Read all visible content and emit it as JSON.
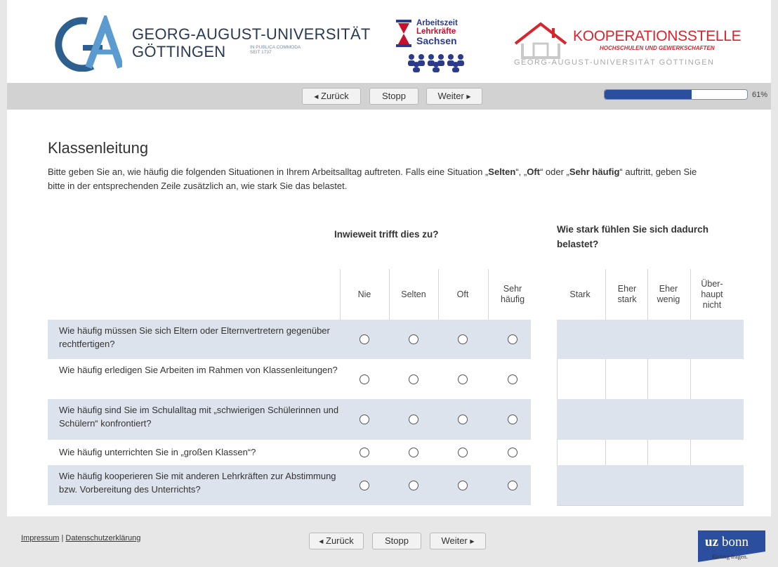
{
  "header": {
    "university": {
      "line1": "GEORG-AUGUST-UNIVERSITÄT",
      "line2": "GÖTTINGEN",
      "motto_line1": "IN PUBLICA COMMODA",
      "motto_line2": "SEIT 1737"
    },
    "alk": {
      "line1": "Arbeitszeit",
      "line2": "Lehrkräfte",
      "line3": "Sachsen"
    },
    "koop": {
      "title": "KOOPERATIONSSTELLE",
      "subtitle": "HOCHSCHULEN UND GEWERKSCHAFTEN",
      "university": "GEORG-AUGUST-UNIVERSITÄT GÖTTINGEN"
    }
  },
  "nav": {
    "back_label": "Zurück",
    "stop_label": "Stopp",
    "next_label": "Weiter",
    "progress_fraction": 0.61,
    "progress_text": "61%"
  },
  "content": {
    "title": "Klassenleitung",
    "intro_part1": "Bitte geben Sie an, wie häufig die folgenden Situationen in Ihrem Arbeitsalltag auftreten. Falls eine Situation „",
    "intro_bold1": "Selten",
    "intro_part2": "“, „",
    "intro_bold2": "Oft",
    "intro_part3": "“ oder „",
    "intro_bold3": "Sehr häufig",
    "intro_part4": "“ auftritt, geben Sie bitte in der entsprechenden Zeile zusätzlich an, wie stark Sie das belastet.",
    "group1_header": "Inwieweit trifft dies zu?",
    "group2_header": "Wie stark fühlen Sie sich dadurch belastet?",
    "freq_columns": [
      "Nie",
      "Selten",
      "Oft",
      "Sehr häufig"
    ],
    "burden_columns": [
      "Stark",
      "Eher stark",
      "Eher wenig",
      "Über-haupt nicht"
    ],
    "questions": [
      "Wie häufig müssen Sie sich Eltern oder Elternvertretern gegenüber rechtfertigen?",
      "Wie häufig erledigen Sie Arbeiten im Rahmen von Klassenleitungen?",
      "Wie häufig sind Sie im Schulalltag mit „schwierigen Schülerinnen und Schülern“ konfrontiert?",
      "Wie häufig unterrichten Sie in „großen Klassen“?",
      "Wie häufig kooperieren Sie mit anderen Lehrkräften zur Abstimmung bzw. Vorbereitung des Unterrichts?"
    ]
  },
  "footer": {
    "impressum": "Impressum",
    "separator": "|",
    "datenschutz": "Datenschutzerklärung",
    "uzbonn_logo": "uzbonn",
    "uzbonn_tagline": "Richtig fragen."
  },
  "colors": {
    "progress": "#2b4f9e",
    "row_shade": "#dde3ec",
    "koop_red": "#d9262e",
    "navbar": "#d2d2d2"
  }
}
